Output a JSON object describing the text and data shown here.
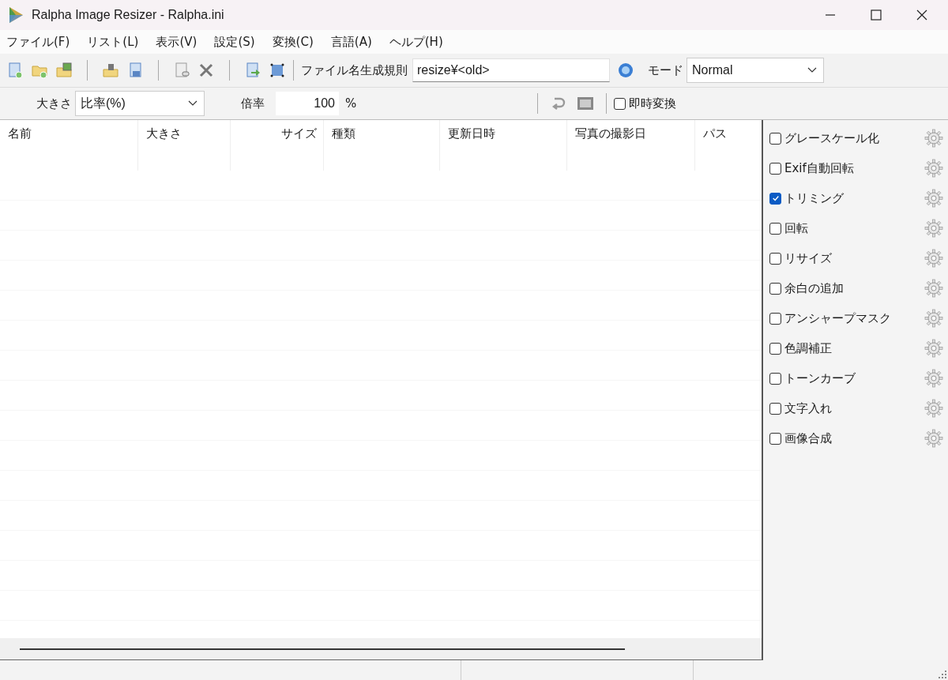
{
  "window": {
    "title": "Ralpha Image Resizer - Ralpha.ini"
  },
  "menu": [
    "ファイル(F)",
    "リスト(L)",
    "表示(V)",
    "設定(S)",
    "変換(C)",
    "言語(A)",
    "ヘルプ(H)"
  ],
  "toolbar": {
    "rule_label": "ファイル名生成規則",
    "rule_value": "resize¥<old>",
    "mode_label": "モード",
    "mode_value": "Normal"
  },
  "size_bar": {
    "size_label": "大きさ",
    "size_value": "比率(%)",
    "scale_label": "倍率",
    "scale_value": "100",
    "unit": "%",
    "instant": {
      "label": "即時変換",
      "checked": false
    }
  },
  "table": {
    "columns": [
      "名前",
      "大きさ",
      "サイズ",
      "種類",
      "更新日時",
      "写真の撮影日",
      "パス"
    ]
  },
  "filters": [
    {
      "label": "グレースケール化",
      "checked": false
    },
    {
      "label": "Exif自動回転",
      "checked": false
    },
    {
      "label": "トリミング",
      "checked": true
    },
    {
      "label": "回転",
      "checked": false
    },
    {
      "label": "リサイズ",
      "checked": false
    },
    {
      "label": "余白の追加",
      "checked": false
    },
    {
      "label": "アンシャープマスク",
      "checked": false
    },
    {
      "label": "色調補正",
      "checked": false
    },
    {
      "label": "トーンカーブ",
      "checked": false
    },
    {
      "label": "文字入れ",
      "checked": false
    },
    {
      "label": "画像合成",
      "checked": false
    }
  ]
}
